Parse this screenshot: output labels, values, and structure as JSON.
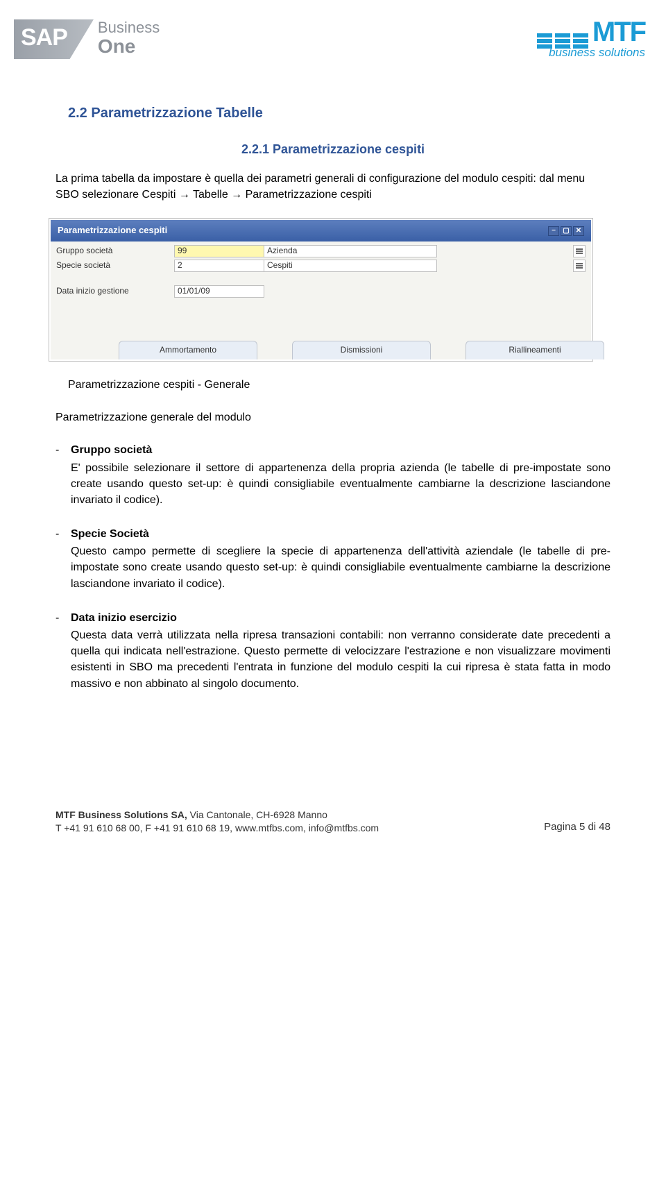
{
  "logos": {
    "sap": {
      "brand": "SAP",
      "line1": "Business",
      "line2": "One"
    },
    "mtf": {
      "brand": "MTF",
      "tagline": "business solutions"
    }
  },
  "heading1": "2.2  Parametrizzazione Tabelle",
  "heading2": "2.2.1 Parametrizzazione cespiti",
  "intro": "La prima tabella da impostare è quella dei parametri generali di configurazione del modulo cespiti: dal menu SBO selezionare Cespiti → Tabelle → Parametrizzazione cespiti",
  "screenshot": {
    "title": "Parametrizzazione cespiti",
    "rows": [
      {
        "label": "Gruppo società",
        "value": "99",
        "desc": "Azienda",
        "highlight": true,
        "picker": true
      },
      {
        "label": "Specie società",
        "value": "2",
        "desc": "Cespiti",
        "highlight": false,
        "picker": true
      }
    ],
    "dateRow": {
      "label": "Data inizio gestione",
      "value": "01/01/09"
    },
    "tabs": [
      "Ammortamento",
      "Dismissioni",
      "Riallineamenti"
    ]
  },
  "subLabel": "Parametrizzazione cespiti - Generale",
  "moduloLine": "Parametrizzazione generale del modulo",
  "items": [
    {
      "title": "Gruppo società",
      "body": "E' possibile selezionare il settore di appartenenza della propria azienda (le tabelle di pre-impostate sono create usando questo set-up: è quindi consigliabile eventualmente cambiarne la descrizione lasciandone invariato il codice)."
    },
    {
      "title": "Specie Società",
      "body": "Questo campo permette di scegliere la specie di appartenenza dell'attività aziendale (le tabelle di pre-impostate sono create usando questo set-up: è quindi consigliabile eventualmente cambiarne la descrizione lasciandone invariato il codice)."
    },
    {
      "title": "Data inizio esercizio",
      "body": "Questa data verrà utilizzata nella ripresa transazioni contabili: non verranno considerate date precedenti a quella qui indicata nell'estrazione. Questo permette di velocizzare l'estrazione e non visualizzare movimenti esistenti in SBO ma precedenti l'entrata in funzione del modulo cespiti la cui ripresa è stata fatta in modo massivo e non abbinato al singolo documento."
    }
  ],
  "footer": {
    "line1_bold": "MTF Business Solutions SA,",
    "line1_rest": " Via Cantonale, CH-6928 Manno",
    "line2": "T +41 91 610 68 00, F +41 91 610 68 19, www.mtfbs.com, info@mtfbs.com",
    "pager": "Pagina 5 di 48"
  }
}
